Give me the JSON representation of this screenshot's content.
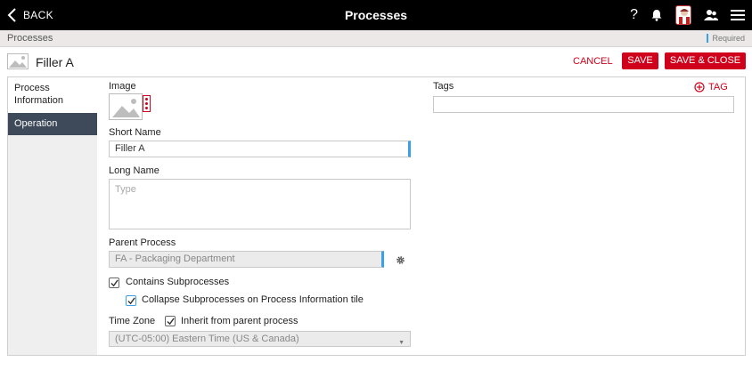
{
  "topbar": {
    "back_label": "BACK",
    "title": "Processes",
    "help_glyph": "?"
  },
  "breadcrumb": {
    "text": "Processes",
    "required_label": "Required"
  },
  "header": {
    "title": "Filler A",
    "cancel_label": "CANCEL",
    "save_label": "SAVE",
    "save_close_label": "SAVE & CLOSE"
  },
  "sidebar": {
    "items": [
      {
        "label": "Process Information"
      },
      {
        "label": "Operation"
      }
    ]
  },
  "form": {
    "image_label": "Image",
    "short_name_label": "Short Name",
    "short_name_value": "Filler A",
    "long_name_label": "Long Name",
    "long_name_placeholder": "Type",
    "parent_process_label": "Parent Process",
    "parent_process_value": "FA - Packaging Department",
    "contains_subprocesses_label": "Contains Subprocesses",
    "collapse_subprocesses_label": "Collapse Subprocesses on Process Information tile",
    "time_zone_label": "Time Zone",
    "inherit_label": "Inherit from parent process",
    "time_zone_value": "(UTC-05:00) Eastern Time (US & Canada)",
    "tags_label": "Tags",
    "add_tag_label": "TAG"
  },
  "colors": {
    "accent": "#d0021b",
    "topbar": "#000000",
    "selected_nav": "#3e4a5a",
    "required": "#3aa0e8"
  }
}
